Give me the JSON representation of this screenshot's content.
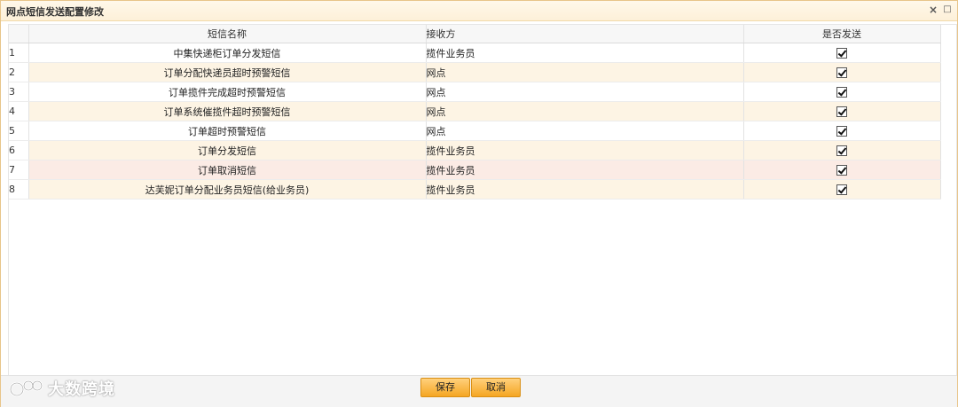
{
  "window": {
    "title": "网点短信发送配置修改",
    "close_glyph": "×",
    "maximize_glyph": "□"
  },
  "grid": {
    "columns": {
      "name": "短信名称",
      "receiver": "接收方",
      "send": "是否发送"
    },
    "rows": [
      {
        "index": "1",
        "name": "中集快递柜订单分发短信",
        "receiver": "揽件业务员",
        "send": true
      },
      {
        "index": "2",
        "name": "订单分配快递员超时预警短信",
        "receiver": "网点",
        "send": true
      },
      {
        "index": "3",
        "name": "订单揽件完成超时预警短信",
        "receiver": "网点",
        "send": true
      },
      {
        "index": "4",
        "name": "订单系统催揽件超时预警短信",
        "receiver": "网点",
        "send": true
      },
      {
        "index": "5",
        "name": "订单超时预警短信",
        "receiver": "网点",
        "send": true
      },
      {
        "index": "6",
        "name": "订单分发短信",
        "receiver": "揽件业务员",
        "send": true
      },
      {
        "index": "7",
        "name": "订单取消短信",
        "receiver": "揽件业务员",
        "send": true
      },
      {
        "index": "8",
        "name": "达芙妮订单分配业务员短信(给业务员)",
        "receiver": "揽件业务员",
        "send": true
      }
    ]
  },
  "footer": {
    "save_label": "保存",
    "cancel_label": "取消"
  },
  "watermark": {
    "text": "大数跨境"
  },
  "colors": {
    "accent": "#f5a623",
    "row_alt": "#fdf4e4",
    "row_selected": "#fbebe5"
  },
  "icons": {
    "close": "close-icon",
    "maximize": "maximize-icon",
    "checkbox": "checkbox-icon",
    "watermark_logo": "watermark-logo-icon"
  }
}
